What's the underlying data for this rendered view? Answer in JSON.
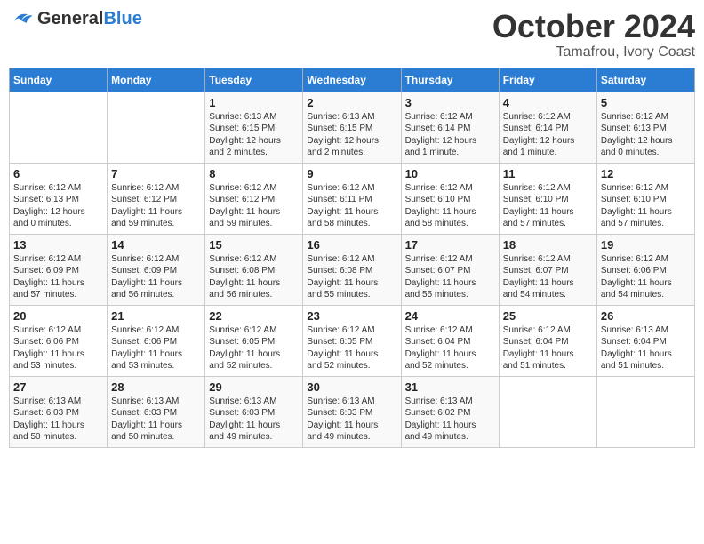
{
  "header": {
    "logo_line1": "General",
    "logo_line2": "Blue",
    "month": "October 2024",
    "location": "Tamafrou, Ivory Coast"
  },
  "weekdays": [
    "Sunday",
    "Monday",
    "Tuesday",
    "Wednesday",
    "Thursday",
    "Friday",
    "Saturday"
  ],
  "weeks": [
    [
      {
        "day": "",
        "content": ""
      },
      {
        "day": "",
        "content": ""
      },
      {
        "day": "1",
        "content": "Sunrise: 6:13 AM\nSunset: 6:15 PM\nDaylight: 12 hours\nand 2 minutes."
      },
      {
        "day": "2",
        "content": "Sunrise: 6:13 AM\nSunset: 6:15 PM\nDaylight: 12 hours\nand 2 minutes."
      },
      {
        "day": "3",
        "content": "Sunrise: 6:12 AM\nSunset: 6:14 PM\nDaylight: 12 hours\nand 1 minute."
      },
      {
        "day": "4",
        "content": "Sunrise: 6:12 AM\nSunset: 6:14 PM\nDaylight: 12 hours\nand 1 minute."
      },
      {
        "day": "5",
        "content": "Sunrise: 6:12 AM\nSunset: 6:13 PM\nDaylight: 12 hours\nand 0 minutes."
      }
    ],
    [
      {
        "day": "6",
        "content": "Sunrise: 6:12 AM\nSunset: 6:13 PM\nDaylight: 12 hours\nand 0 minutes."
      },
      {
        "day": "7",
        "content": "Sunrise: 6:12 AM\nSunset: 6:12 PM\nDaylight: 11 hours\nand 59 minutes."
      },
      {
        "day": "8",
        "content": "Sunrise: 6:12 AM\nSunset: 6:12 PM\nDaylight: 11 hours\nand 59 minutes."
      },
      {
        "day": "9",
        "content": "Sunrise: 6:12 AM\nSunset: 6:11 PM\nDaylight: 11 hours\nand 58 minutes."
      },
      {
        "day": "10",
        "content": "Sunrise: 6:12 AM\nSunset: 6:10 PM\nDaylight: 11 hours\nand 58 minutes."
      },
      {
        "day": "11",
        "content": "Sunrise: 6:12 AM\nSunset: 6:10 PM\nDaylight: 11 hours\nand 57 minutes."
      },
      {
        "day": "12",
        "content": "Sunrise: 6:12 AM\nSunset: 6:10 PM\nDaylight: 11 hours\nand 57 minutes."
      }
    ],
    [
      {
        "day": "13",
        "content": "Sunrise: 6:12 AM\nSunset: 6:09 PM\nDaylight: 11 hours\nand 57 minutes."
      },
      {
        "day": "14",
        "content": "Sunrise: 6:12 AM\nSunset: 6:09 PM\nDaylight: 11 hours\nand 56 minutes."
      },
      {
        "day": "15",
        "content": "Sunrise: 6:12 AM\nSunset: 6:08 PM\nDaylight: 11 hours\nand 56 minutes."
      },
      {
        "day": "16",
        "content": "Sunrise: 6:12 AM\nSunset: 6:08 PM\nDaylight: 11 hours\nand 55 minutes."
      },
      {
        "day": "17",
        "content": "Sunrise: 6:12 AM\nSunset: 6:07 PM\nDaylight: 11 hours\nand 55 minutes."
      },
      {
        "day": "18",
        "content": "Sunrise: 6:12 AM\nSunset: 6:07 PM\nDaylight: 11 hours\nand 54 minutes."
      },
      {
        "day": "19",
        "content": "Sunrise: 6:12 AM\nSunset: 6:06 PM\nDaylight: 11 hours\nand 54 minutes."
      }
    ],
    [
      {
        "day": "20",
        "content": "Sunrise: 6:12 AM\nSunset: 6:06 PM\nDaylight: 11 hours\nand 53 minutes."
      },
      {
        "day": "21",
        "content": "Sunrise: 6:12 AM\nSunset: 6:06 PM\nDaylight: 11 hours\nand 53 minutes."
      },
      {
        "day": "22",
        "content": "Sunrise: 6:12 AM\nSunset: 6:05 PM\nDaylight: 11 hours\nand 52 minutes."
      },
      {
        "day": "23",
        "content": "Sunrise: 6:12 AM\nSunset: 6:05 PM\nDaylight: 11 hours\nand 52 minutes."
      },
      {
        "day": "24",
        "content": "Sunrise: 6:12 AM\nSunset: 6:04 PM\nDaylight: 11 hours\nand 52 minutes."
      },
      {
        "day": "25",
        "content": "Sunrise: 6:12 AM\nSunset: 6:04 PM\nDaylight: 11 hours\nand 51 minutes."
      },
      {
        "day": "26",
        "content": "Sunrise: 6:13 AM\nSunset: 6:04 PM\nDaylight: 11 hours\nand 51 minutes."
      }
    ],
    [
      {
        "day": "27",
        "content": "Sunrise: 6:13 AM\nSunset: 6:03 PM\nDaylight: 11 hours\nand 50 minutes."
      },
      {
        "day": "28",
        "content": "Sunrise: 6:13 AM\nSunset: 6:03 PM\nDaylight: 11 hours\nand 50 minutes."
      },
      {
        "day": "29",
        "content": "Sunrise: 6:13 AM\nSunset: 6:03 PM\nDaylight: 11 hours\nand 49 minutes."
      },
      {
        "day": "30",
        "content": "Sunrise: 6:13 AM\nSunset: 6:03 PM\nDaylight: 11 hours\nand 49 minutes."
      },
      {
        "day": "31",
        "content": "Sunrise: 6:13 AM\nSunset: 6:02 PM\nDaylight: 11 hours\nand 49 minutes."
      },
      {
        "day": "",
        "content": ""
      },
      {
        "day": "",
        "content": ""
      }
    ]
  ]
}
